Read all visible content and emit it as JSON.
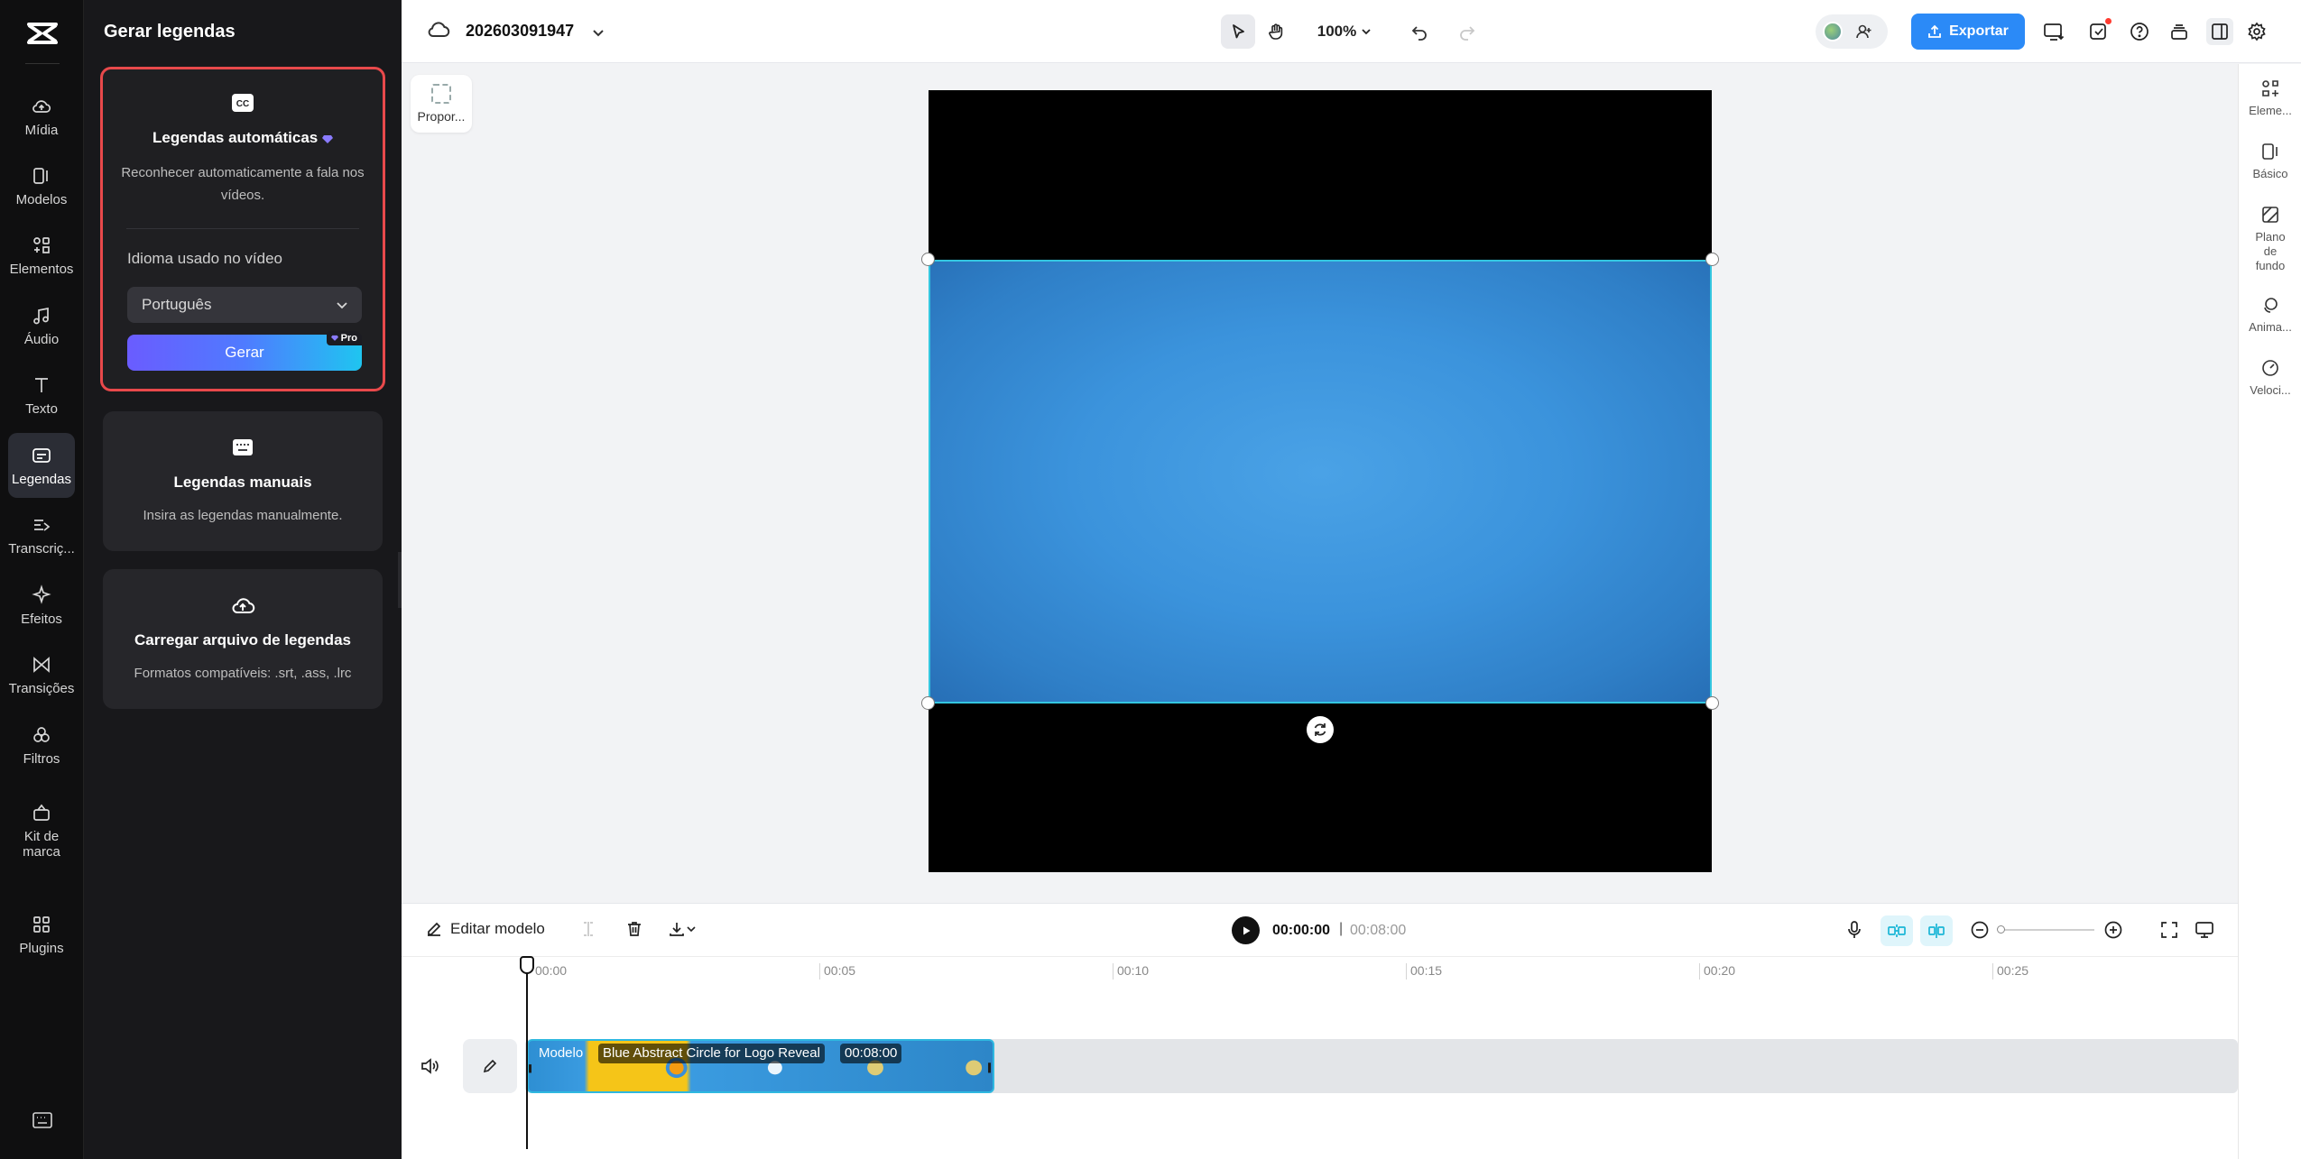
{
  "panel": {
    "title": "Gerar legendas",
    "auto": {
      "title": "Legendas automáticas",
      "description": "Reconhecer automaticamente a fala nos vídeos.",
      "language_label": "Idioma usado no vídeo",
      "language_value": "Português",
      "generate_label": "Gerar",
      "pro_badge": "Pro"
    },
    "manual": {
      "title": "Legendas manuais",
      "description": "Insira as legendas manualmente."
    },
    "upload": {
      "title": "Carregar arquivo de legendas",
      "description": "Formatos compatíveis: .srt, .ass, .lrc"
    }
  },
  "nav": {
    "items": [
      {
        "label": "Mídia",
        "icon": "cloud-upload-icon"
      },
      {
        "label": "Modelos",
        "icon": "template-icon"
      },
      {
        "label": "Elementos",
        "icon": "elements-icon"
      },
      {
        "label": "Áudio",
        "icon": "music-note-icon"
      },
      {
        "label": "Texto",
        "icon": "text-icon"
      },
      {
        "label": "Legendas",
        "icon": "captions-icon"
      },
      {
        "label": "Transcriç...",
        "icon": "transcript-icon"
      },
      {
        "label": "Efeitos",
        "icon": "sparkle-icon"
      },
      {
        "label": "Transições",
        "icon": "transition-icon"
      },
      {
        "label": "Filtros",
        "icon": "filter-icon"
      },
      {
        "label": "Kit de marca",
        "icon": "brand-kit-icon"
      },
      {
        "label": "Plugins",
        "icon": "plugins-icon"
      }
    ],
    "active": "Legendas"
  },
  "topbar": {
    "project_name": "202603091947",
    "zoom": "100%",
    "export_label": "Exportar"
  },
  "canvas": {
    "ratio_label": "Propor..."
  },
  "rightrail": {
    "items": [
      {
        "label": "Eleme...",
        "icon": "elements-grid-icon"
      },
      {
        "label": "Básico",
        "icon": "basic-icon"
      },
      {
        "label": "Plano de fundo",
        "icon": "background-icon"
      },
      {
        "label": "Anima...",
        "icon": "animation-icon"
      },
      {
        "label": "Veloci...",
        "icon": "speed-icon"
      }
    ]
  },
  "timeline": {
    "edit_template_label": "Editar modelo",
    "current_time": "00:00:00",
    "separator": "|",
    "total_time": "00:08:00",
    "ruler_ticks": [
      "00:00",
      "00:05",
      "00:10",
      "00:15",
      "00:20",
      "00:25"
    ],
    "clip": {
      "tag": "Modelo",
      "name": "Blue Abstract Circle for Logo Reveal",
      "duration": "00:08:00"
    }
  },
  "colors": {
    "accent": "#2b8af7",
    "highlight_border": "#e8494b",
    "selection": "#34c6e0",
    "gradient_start": "#6a5cff",
    "gradient_end": "#1fc5f0"
  }
}
